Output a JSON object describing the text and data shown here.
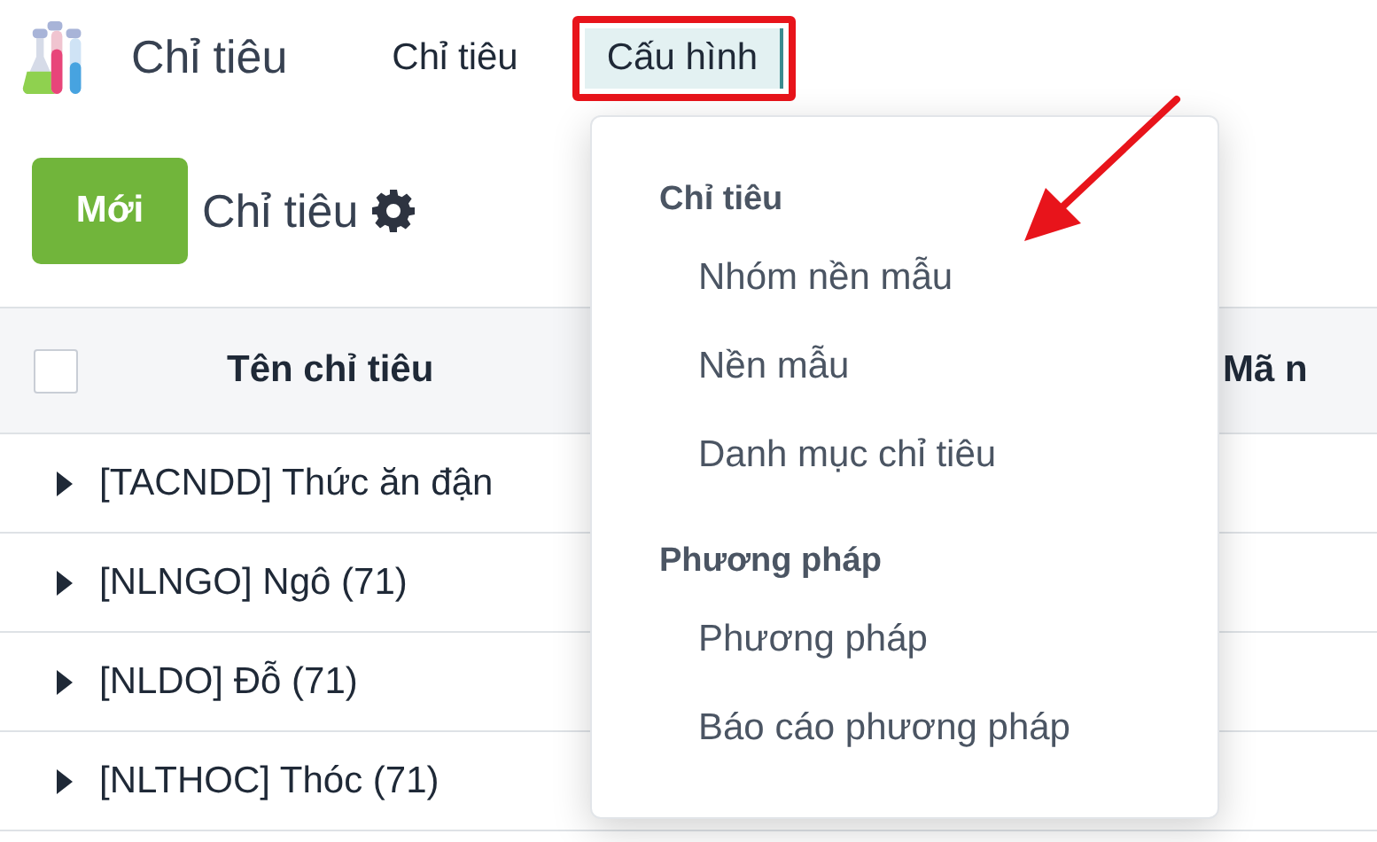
{
  "app": {
    "name": "Chỉ tiêu"
  },
  "menu": [
    {
      "label": "Chỉ tiêu",
      "selected": false,
      "highlighted": false
    },
    {
      "label": "Cấu hình",
      "selected": true,
      "highlighted": true
    }
  ],
  "control_bar": {
    "new_button": "Mới",
    "title": "Chỉ tiêu"
  },
  "table": {
    "select_all": {
      "checked": false
    },
    "columns": [
      "Tên chỉ tiêu",
      "Mã n"
    ],
    "rows": [
      {
        "name": "[TACNDD] Thức ăn đận",
        "expanded": false
      },
      {
        "name": "[NLNGO] Ngô (71)",
        "expanded": false
      },
      {
        "name": "[NLDO] Đỗ (71)",
        "expanded": false
      },
      {
        "name": "[NLTHOC] Thóc (71)",
        "expanded": false
      }
    ]
  },
  "dropdown": {
    "sections": [
      {
        "header": "Chỉ tiêu",
        "items": [
          "Nhóm nền mẫu",
          "Nền mẫu",
          "Danh mục chỉ tiêu"
        ]
      },
      {
        "header": "Phương pháp",
        "items": [
          "Phương pháp",
          "Báo cáo phương pháp"
        ]
      }
    ]
  },
  "annotations": [
    {
      "kind": "arrow"
    }
  ]
}
